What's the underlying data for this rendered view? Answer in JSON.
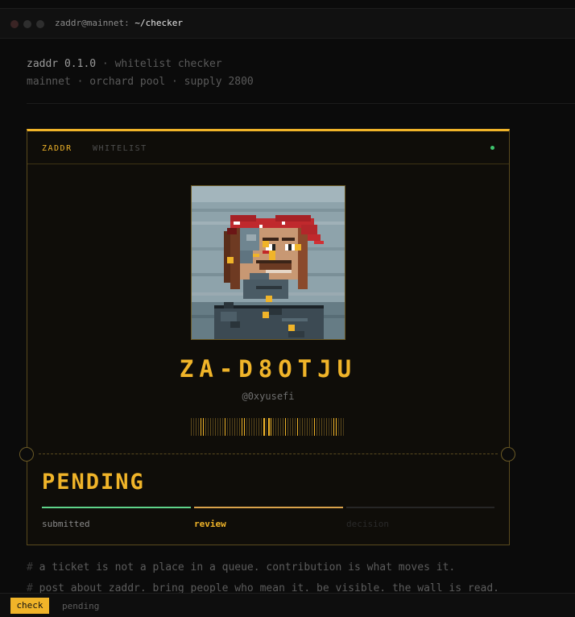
{
  "window": {
    "user_host": "zaddr@mainnet:",
    "path": "~/checker"
  },
  "meta": {
    "app": "zaddr 0.1.0",
    "sep": " · ",
    "tool": "whitelist checker",
    "line2": "mainnet · orchard pool · supply 2800"
  },
  "card": {
    "tab_active": "ZADDR",
    "tab_inactive": "WHITELIST",
    "ticket_id": "ZA-D8OTJU",
    "handle": "@0xyusefi",
    "status": "PENDING",
    "steps": [
      {
        "label": "submitted",
        "state": "done"
      },
      {
        "label": "review",
        "state": "active"
      },
      {
        "label": "decision",
        "state": "upcoming"
      }
    ]
  },
  "comments": [
    {
      "hash": "#",
      "text": "a ticket is not a place in a queue. contribution is what moves it."
    },
    {
      "hash": "#",
      "text": "post about zaddr. bring people who mean it. be visible. the wall is read."
    }
  ],
  "statusbar": {
    "button": "check",
    "state": "pending"
  },
  "colors": {
    "accent": "#f0b429",
    "done": "#5fd38a",
    "review": "#d9a24b",
    "live": "#3ec46d"
  },
  "icons": [
    "window-close-icon",
    "window-minimize-icon",
    "window-maximize-icon",
    "live-indicator-icon"
  ]
}
